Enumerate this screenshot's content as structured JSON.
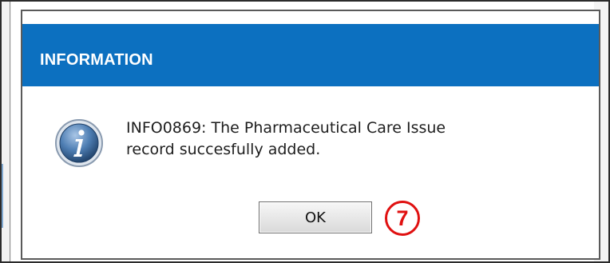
{
  "dialog": {
    "title": "INFORMATION",
    "icon": "info-icon",
    "message_line1": "INFO0869: The Pharmaceutical Care Issue",
    "message_line2": "record succesfully added.",
    "ok_label": "OK"
  },
  "annotation": {
    "step_number": "7"
  },
  "colors": {
    "titlebar": "#0c70c0",
    "step_badge": "#e01010"
  }
}
